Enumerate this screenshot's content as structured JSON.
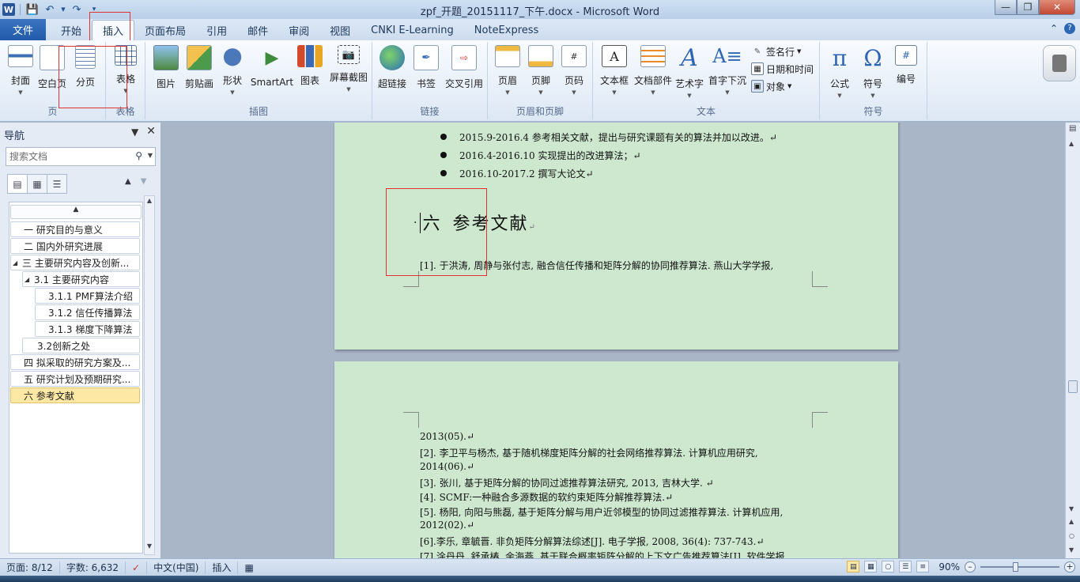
{
  "window": {
    "title": "zpf_开题_20151117_下午.docx - Microsoft Word",
    "app_logo": "W",
    "qat_icons": [
      "save-icon",
      "undo-icon",
      "redo-icon",
      "customize-icon"
    ]
  },
  "tabs": [
    "文件",
    "开始",
    "插入",
    "页面布局",
    "引用",
    "邮件",
    "审阅",
    "视图",
    "CNKI E-Learning",
    "NoteExpress"
  ],
  "active_tab": "插入",
  "ribbon": {
    "groups": {
      "page": "页",
      "table": "表格",
      "illustrations": "插图",
      "links": "链接",
      "header_footer": "页眉和页脚",
      "text": "文本",
      "symbols": "符号"
    },
    "buttons": {
      "cover": "封面",
      "blank_page": "空白页",
      "page_break": "分页",
      "table": "表格",
      "picture": "图片",
      "clip_art": "剪贴画",
      "shapes": "形状",
      "smartart": "SmartArt",
      "chart": "图表",
      "screenshot": "屏幕截图",
      "hyperlink": "超链接",
      "bookmark": "书签",
      "cross_ref": "交叉引用",
      "header": "页眉",
      "footer": "页脚",
      "page_number": "页码",
      "text_box": "文本框",
      "quick_parts": "文档部件",
      "wordart": "艺术字",
      "drop_cap": "首字下沉",
      "signature_line": "签名行",
      "date_time": "日期和时间",
      "object": "对象",
      "equation": "公式",
      "symbol": "符号",
      "number": "编号"
    }
  },
  "nav": {
    "title": "导航",
    "search_placeholder": "搜索文档",
    "headings": [
      {
        "text": "一 研究目的与意义",
        "level": 1,
        "expander": ""
      },
      {
        "text": "二 国内外研究进展",
        "level": 1,
        "expander": ""
      },
      {
        "text": "三 主要研究内容及创新...",
        "level": 1,
        "expander": "◢"
      },
      {
        "text": "3.1 主要研究内容",
        "level": 2,
        "expander": "◢"
      },
      {
        "text": "3.1.1  PMF算法介绍",
        "level": 3,
        "expander": ""
      },
      {
        "text": "3.1.2  信任传播算法",
        "level": 3,
        "expander": ""
      },
      {
        "text": "3.1.3  梯度下降算法",
        "level": 3,
        "expander": ""
      },
      {
        "text": "3.2创新之处",
        "level": 2,
        "expander": ""
      },
      {
        "text": "四 拟采取的研究方案及...",
        "level": 1,
        "expander": ""
      },
      {
        "text": "五 研究计划及预期研究...",
        "level": 1,
        "expander": ""
      },
      {
        "text": "六 参考文献",
        "level": 1,
        "expander": "",
        "selected": true
      }
    ]
  },
  "document": {
    "bullets": [
      "2015.9-2016.4 参考相关文献，提出与研究课题有关的算法并加以改进。↵",
      "2016.4-2016.10 实现提出的改进算法；↵",
      "2016.10-2017.2 撰写大论文↵"
    ],
    "heading_num": "六",
    "heading_text": "参考文献",
    "heading_mark": "↵",
    "ref1": "[1]. 于洪涛, 周静与张付志, 融合信任传播和矩阵分解的协同推荐算法. 燕山大学学报,",
    "page2_lines": [
      "2013(05).↵",
      "[2]. 李卫平与杨杰, 基于随机梯度矩阵分解的社会网络推荐算法. 计算机应用研究,",
      "2014(06).↵",
      "[3]. 张川, 基于矩阵分解的协同过滤推荐算法研究, 2013, 吉林大学. ↵",
      "[4]. SCMF:一种融合多源数据的软约束矩阵分解推荐算法.↵",
      "[5]. 杨阳, 向阳与熊磊, 基于矩阵分解与用户近邻模型的协同过滤推荐算法. 计算机应用,",
      "2012(02).↵",
      "[6].李乐, 章毓晋. 非负矩阵分解算法综述[J]. 电子学报, 2008, 36(4): 737-743.↵",
      "[7].涂丹丹, 舒承椿, 余海燕. 基于联合概率矩阵分解的上下文广告推荐算法[J]. 软件学报,"
    ]
  },
  "status": {
    "page": "页面: 8/12",
    "words": "字数: 6,632",
    "language": "中文(中国)",
    "mode": "插入",
    "zoom": "90%",
    "zoom_percent": 90
  }
}
